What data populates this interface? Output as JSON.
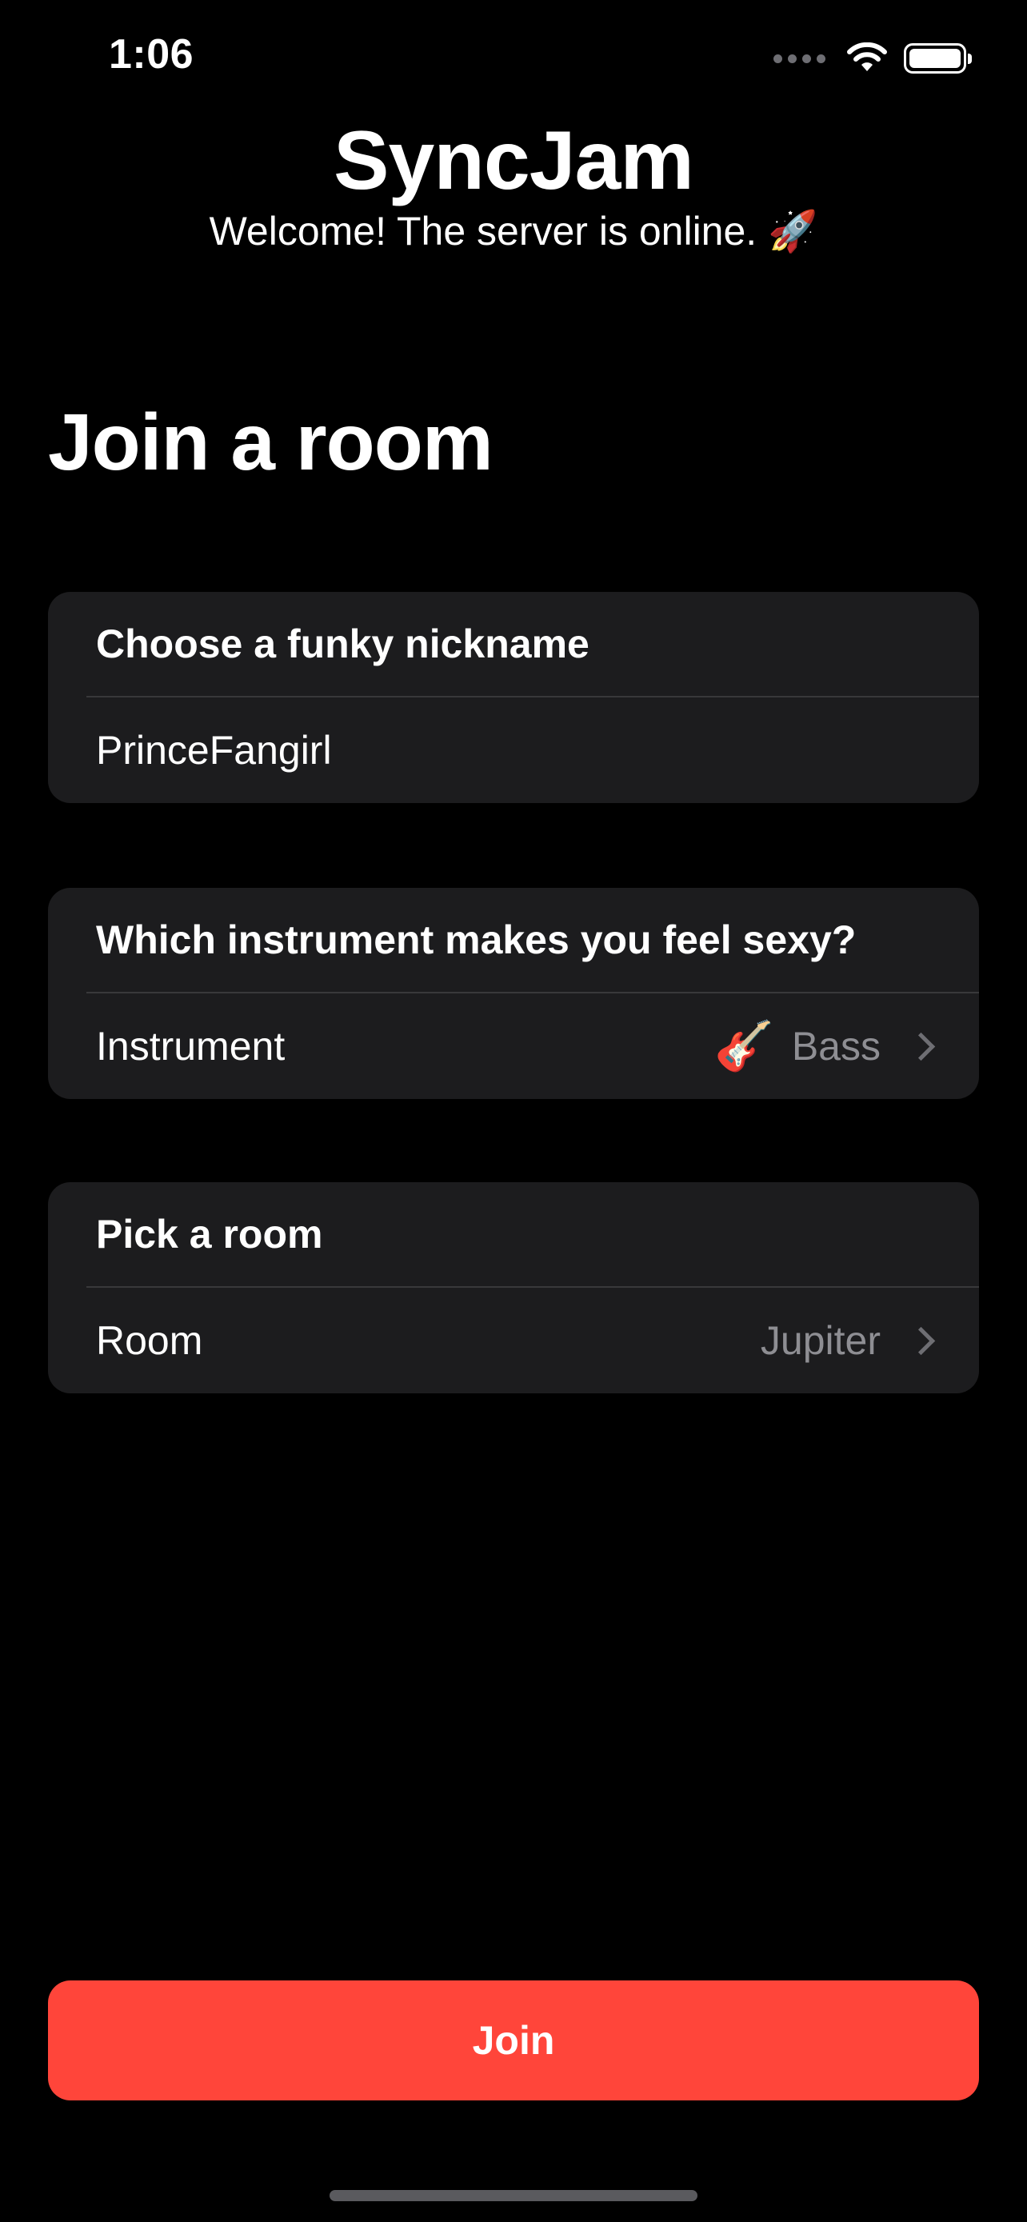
{
  "status_bar": {
    "time": "1:06"
  },
  "header": {
    "app_title": "SyncJam",
    "subtitle": "Welcome! The server is online. 🚀"
  },
  "page_title": "Join a room",
  "nickname_section": {
    "header": "Choose a funky nickname",
    "value": "PrinceFangirl"
  },
  "instrument_section": {
    "header": "Which instrument makes you feel sexy?",
    "label": "Instrument",
    "value_emoji": "🎸",
    "value": "Bass"
  },
  "room_section": {
    "header": "Pick a room",
    "label": "Room",
    "value": "Jupiter"
  },
  "join_button": {
    "label": "Join"
  },
  "colors": {
    "accent": "#ff453a",
    "card_background": "#1c1c1e",
    "secondary_text": "#8e8e93"
  },
  "icons": [
    "wifi-icon",
    "battery-icon",
    "chevron-right-icon",
    "rocket-emoji",
    "guitar-emoji"
  ]
}
